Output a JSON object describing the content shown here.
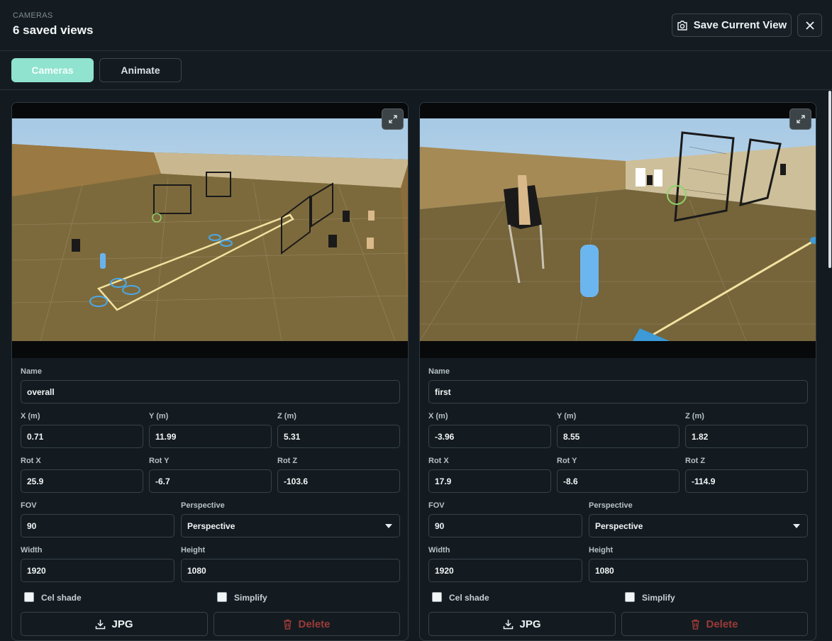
{
  "header": {
    "eyebrow": "CAMERAS",
    "title": "6 saved views",
    "save_label": "Save Current View",
    "save_icon": "camera-icon",
    "close_icon": "close-icon"
  },
  "tabs": [
    {
      "label": "Cameras",
      "active": true
    },
    {
      "label": "Animate",
      "active": false
    }
  ],
  "labels": {
    "name": "Name",
    "x": "X (m)",
    "y": "Y (m)",
    "z": "Z (m)",
    "rotx": "Rot X",
    "roty": "Rot Y",
    "rotz": "Rot Z",
    "fov": "FOV",
    "perspective": "Perspective",
    "width": "Width",
    "height": "Height",
    "cel": "Cel shade",
    "simplify": "Simplify",
    "jpg": "JPG",
    "delete": "Delete"
  },
  "cameras": [
    {
      "name": "overall",
      "x": "0.71",
      "y": "11.99",
      "z": "5.31",
      "rotx": "25.9",
      "roty": "-6.7",
      "rotz": "-103.6",
      "fov": "90",
      "perspective": "Perspective",
      "width": "1920",
      "height": "1080",
      "cel_shade": false,
      "simplify": false
    },
    {
      "name": "first",
      "x": "-3.96",
      "y": "8.55",
      "z": "1.82",
      "rotx": "17.9",
      "roty": "-8.6",
      "rotz": "-114.9",
      "fov": "90",
      "perspective": "Perspective",
      "width": "1920",
      "height": "1080",
      "cel_shade": false,
      "simplify": false
    }
  ],
  "colors": {
    "accent": "#8fe3cf",
    "danger": "#9b3a38",
    "background": "#141b20"
  }
}
